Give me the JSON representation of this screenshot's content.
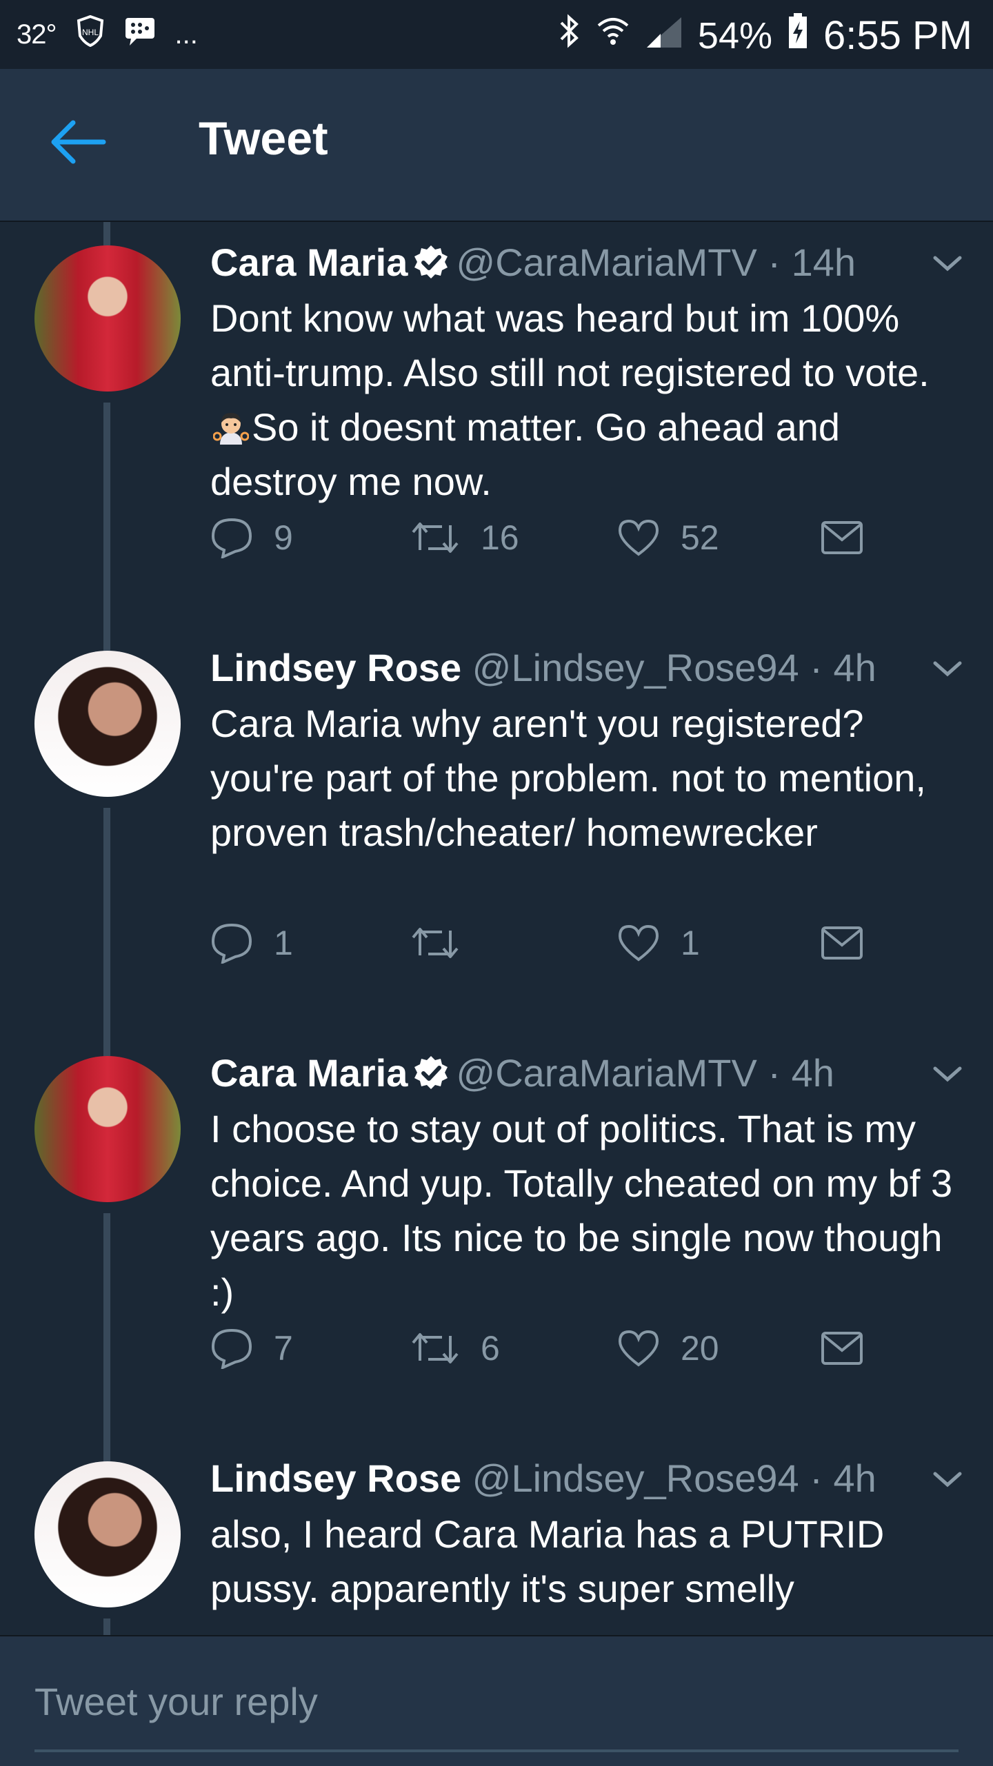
{
  "status_bar": {
    "temperature": "32°",
    "overflow": "...",
    "battery": "54%",
    "time": "6:55 PM"
  },
  "header": {
    "title": "Tweet"
  },
  "tweets": [
    {
      "name": "Cara Maria",
      "verified": true,
      "handle": "@CaraMariaMTV · 14h",
      "text_before_emoji": "Dont know what was heard but im 100% anti-trump. Also still not registered to vote. ",
      "emoji": "person-gesturing-ok",
      "text_after_emoji": "So it doesnt matter. Go ahead and destroy me now.",
      "replies": "9",
      "retweets": "16",
      "likes": "52"
    },
    {
      "name": "Lindsey Rose",
      "verified": false,
      "handle": "@Lindsey_Rose94 · 4h",
      "text": "Cara Maria why aren't you registered? you're part of the problem. not to mention, proven trash/cheater/ homewrecker",
      "replies": "1",
      "retweets": "",
      "likes": "1"
    },
    {
      "name": "Cara Maria",
      "verified": true,
      "handle": "@CaraMariaMTV · 4h",
      "text": "I choose to stay out of politics. That is my choice. And yup. Totally cheated on my bf 3 years ago. Its nice to be single now though :)",
      "replies": "7",
      "retweets": "6",
      "likes": "20"
    },
    {
      "name": "Lindsey Rose",
      "verified": false,
      "handle": "@Lindsey_Rose94 · 4h",
      "text": "also, I heard Cara Maria has a PUTRID pussy. apparently it's super smelly"
    }
  ],
  "composer": {
    "placeholder": "Tweet your reply"
  },
  "colors": {
    "background": "#1b2836",
    "bar": "#243447",
    "accent": "#1da1f2",
    "secondary_text": "#8899a6"
  }
}
